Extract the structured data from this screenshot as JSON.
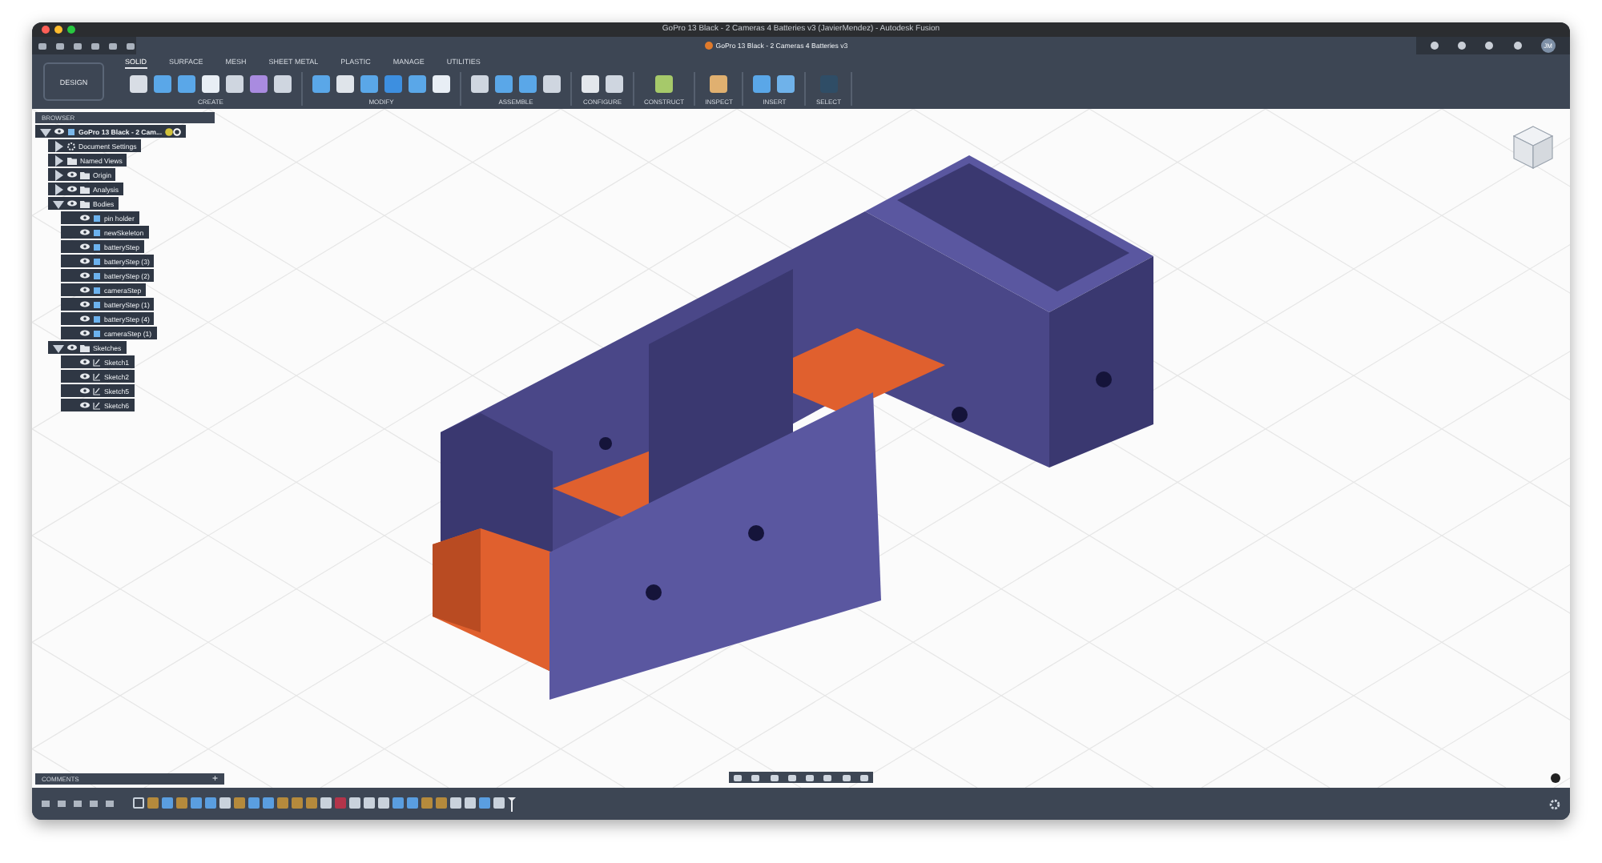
{
  "window": {
    "title": "GoPro 13 Black - 2 Cameras 4 Batteries v3 (JavierMendez) - Autodesk Fusion"
  },
  "document_tab": {
    "title": "GoPro 13 Black - 2 Cameras 4 Batteries v3"
  },
  "user": {
    "initials": "JM"
  },
  "workspace": {
    "label": "DESIGN"
  },
  "tabs": [
    {
      "label": "SOLID",
      "selected": true
    },
    {
      "label": "SURFACE",
      "selected": false
    },
    {
      "label": "MESH",
      "selected": false
    },
    {
      "label": "SHEET METAL",
      "selected": false
    },
    {
      "label": "PLASTIC",
      "selected": false
    },
    {
      "label": "MANAGE",
      "selected": false
    },
    {
      "label": "UTILITIES",
      "selected": false
    }
  ],
  "groups": [
    {
      "label": "CREATE"
    },
    {
      "label": "MODIFY"
    },
    {
      "label": "ASSEMBLE"
    },
    {
      "label": "CONFIGURE"
    },
    {
      "label": "CONSTRUCT"
    },
    {
      "label": "INSPECT"
    },
    {
      "label": "INSERT"
    },
    {
      "label": "SELECT"
    }
  ],
  "browser": {
    "title": "BROWSER",
    "root": {
      "label": "GoPro 13 Black - 2 Cam...",
      "expanded": true,
      "children": [
        {
          "label": "Document Settings",
          "kind": "settings",
          "expanded": false
        },
        {
          "label": "Named Views",
          "kind": "views",
          "expanded": false
        },
        {
          "label": "Origin",
          "kind": "folder",
          "expanded": false
        },
        {
          "label": "Analysis",
          "kind": "folder",
          "expanded": false
        },
        {
          "label": "Bodies",
          "kind": "folder",
          "expanded": true,
          "children": [
            {
              "label": "pin holder",
              "kind": "body"
            },
            {
              "label": "newSkeleton",
              "kind": "body"
            },
            {
              "label": "batteryStep",
              "kind": "body"
            },
            {
              "label": "batteryStep (3)",
              "kind": "body"
            },
            {
              "label": "batteryStep (2)",
              "kind": "body"
            },
            {
              "label": "cameraStep",
              "kind": "body"
            },
            {
              "label": "batteryStep (1)",
              "kind": "body"
            },
            {
              "label": "batteryStep (4)",
              "kind": "body"
            },
            {
              "label": "cameraStep (1)",
              "kind": "body"
            }
          ]
        },
        {
          "label": "Sketches",
          "kind": "folder",
          "expanded": true,
          "children": [
            {
              "label": "Sketch1",
              "kind": "sketch"
            },
            {
              "label": "Sketch2",
              "kind": "sketch"
            },
            {
              "label": "Sketch5",
              "kind": "sketch"
            },
            {
              "label": "Sketch6",
              "kind": "sketch"
            }
          ]
        }
      ]
    }
  },
  "comments": {
    "title": "COMMENTS",
    "add": "+"
  },
  "timeline": [
    {
      "kind": "outline"
    },
    {
      "kind": "sketch"
    },
    {
      "kind": "body"
    },
    {
      "kind": "sketch"
    },
    {
      "kind": "body"
    },
    {
      "kind": "body"
    },
    {
      "kind": "feature"
    },
    {
      "kind": "sketch"
    },
    {
      "kind": "body"
    },
    {
      "kind": "body"
    },
    {
      "kind": "sketch"
    },
    {
      "kind": "sketch"
    },
    {
      "kind": "sketch"
    },
    {
      "kind": "feature"
    },
    {
      "kind": "error"
    },
    {
      "kind": "feature"
    },
    {
      "kind": "feature"
    },
    {
      "kind": "feature"
    },
    {
      "kind": "body"
    },
    {
      "kind": "body"
    },
    {
      "kind": "sketch"
    },
    {
      "kind": "sketch"
    },
    {
      "kind": "feature"
    },
    {
      "kind": "feature"
    },
    {
      "kind": "body"
    },
    {
      "kind": "feature"
    }
  ]
}
